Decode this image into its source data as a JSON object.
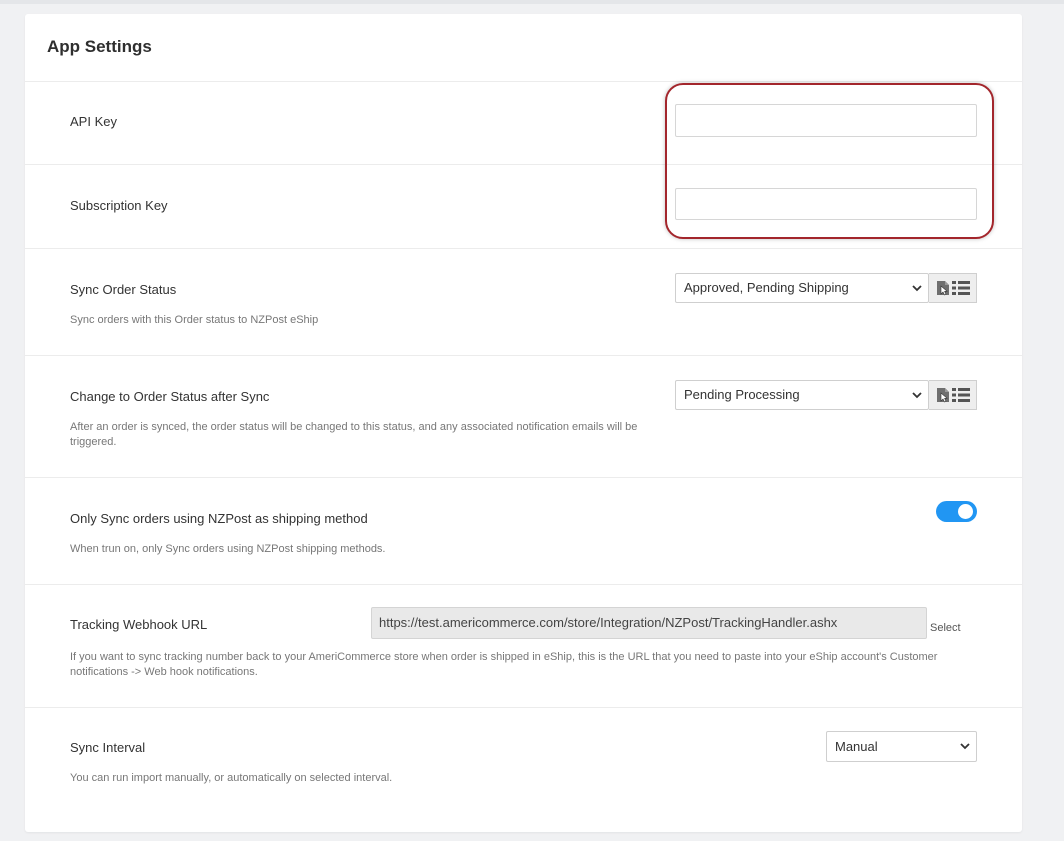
{
  "card": {
    "title": "App Settings"
  },
  "settings": {
    "api_key": {
      "label": "API Key",
      "value": ""
    },
    "subscription_key": {
      "label": "Subscription Key",
      "value": ""
    },
    "sync_order_status": {
      "label": "Sync Order Status",
      "help": "Sync orders with this Order status to NZPost eShip",
      "selected": "Approved, Pending Shipping"
    },
    "change_order_status": {
      "label": "Change to Order Status after Sync",
      "help": "After an order is synced, the order status will be changed to this status, and any associated notification emails will be triggered.",
      "selected": "Pending Processing"
    },
    "only_sync_nzpost": {
      "label": "Only Sync orders using NZPost as shipping method",
      "help": "When trun on, only Sync orders using NZPost shipping methods.",
      "enabled": true
    },
    "tracking_webhook": {
      "label": "Tracking Webhook URL",
      "value": "https://test.americommerce.com/store/Integration/NZPost/TrackingHandler.ashx",
      "select_label": "Select",
      "help": "If you want to sync tracking number back to your AmeriCommerce store when order is shipped in eShip, this is the URL that you need to paste into your eShip account's Customer notifications -> Web hook notifications."
    },
    "sync_interval": {
      "label": "Sync Interval",
      "help": "You can run import manually, or automatically on selected interval.",
      "selected": "Manual"
    }
  },
  "colors": {
    "toggle_on": "#2196f3",
    "highlight": "#a3262c"
  }
}
